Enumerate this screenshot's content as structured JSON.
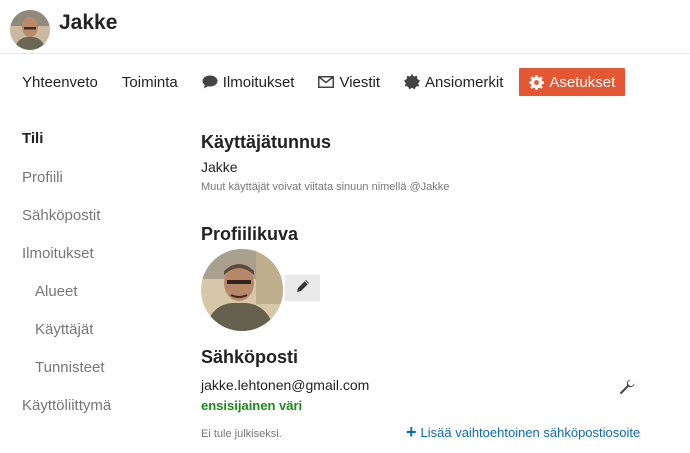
{
  "user": {
    "name": "Jakke"
  },
  "nav": {
    "items": [
      {
        "label": "Yhteenveto",
        "icon": ""
      },
      {
        "label": "Toiminta",
        "icon": ""
      },
      {
        "label": "Ilmoitukset",
        "icon": "comment-icon"
      },
      {
        "label": "Viestit",
        "icon": "envelope-icon"
      },
      {
        "label": "Ansiomerkit",
        "icon": "badge-icon"
      },
      {
        "label": "Asetukset",
        "icon": "gear-icon",
        "active": true
      }
    ],
    "accent_color": "#e45735"
  },
  "sidebar": {
    "items": [
      {
        "label": "Tili",
        "active": true
      },
      {
        "label": "Profiili"
      },
      {
        "label": "Sähköpostit"
      },
      {
        "label": "Ilmoitukset"
      },
      {
        "label": "Alueet"
      },
      {
        "label": "Käyttäjät"
      },
      {
        "label": "Tunnisteet"
      },
      {
        "label": "Käyttöliittymä"
      }
    ]
  },
  "account": {
    "username_title": "Käyttäjätunnus",
    "username": "Jakke",
    "username_hint": "Muut käyttäjät voivat viitata sinuun nimellä @Jakke",
    "profile_pic_title": "Profiilikuva",
    "email_title": "Sähköposti",
    "email": "jakke.lehtonen@gmail.com",
    "primary_label": "ensisijainen väri",
    "email_hint": "Ei tule julkiseksi.",
    "add_email_label": "Lisää vaihtoehtoinen sähköpostiosoite"
  },
  "colors": {
    "primary_green": "#1a8a1a",
    "link_blue": "#0a6bb8"
  }
}
